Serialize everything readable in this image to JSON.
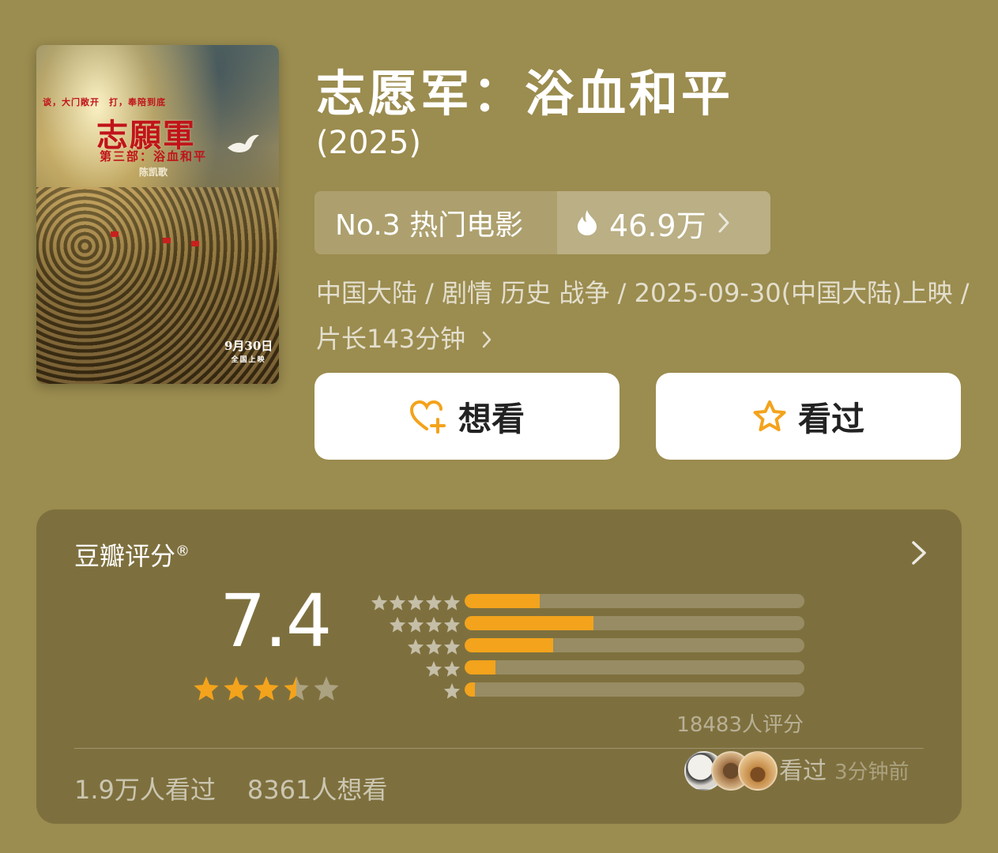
{
  "poster": {
    "tagline": "谈，大门敞开　打，奉陪到底",
    "title": "志願軍",
    "subtitle": "第三部：浴血和平",
    "director": "陈凯歌",
    "date": "9月30日",
    "date_sub": "全国上映"
  },
  "movie": {
    "title": "志愿军：浴血和平",
    "year": "(2025)",
    "rank_label": "No.3 热门电影",
    "heat": "46.9万",
    "meta": "中国大陆 / 剧情 历史 战争 / 2025-09-30(中国大陆)上映 / 片长143分钟",
    "icons": {
      "rank_chevron": "chevron-right-icon",
      "heat": "flame-icon"
    }
  },
  "actions": {
    "want_label": "想看",
    "seen_label": "看过",
    "want_icon": "heart-plus-icon",
    "seen_icon": "star-outline-icon",
    "accent": "#f3a31c"
  },
  "rating": {
    "heading": "豆瓣评分",
    "heading_mark": "®",
    "score": "7.4",
    "stars": 3.5,
    "distribution": [
      {
        "stars": 5,
        "fraction": 0.22
      },
      {
        "stars": 4,
        "fraction": 0.38
      },
      {
        "stars": 3,
        "fraction": 0.26
      },
      {
        "stars": 2,
        "fraction": 0.09
      },
      {
        "stars": 1,
        "fraction": 0.03
      }
    ],
    "count": "18483人评分",
    "watched": "1.9万人看过",
    "wish": "8361人想看",
    "recent_label": "看过",
    "recent_time": "3分钟前",
    "bar_color": "#f3a31c"
  }
}
